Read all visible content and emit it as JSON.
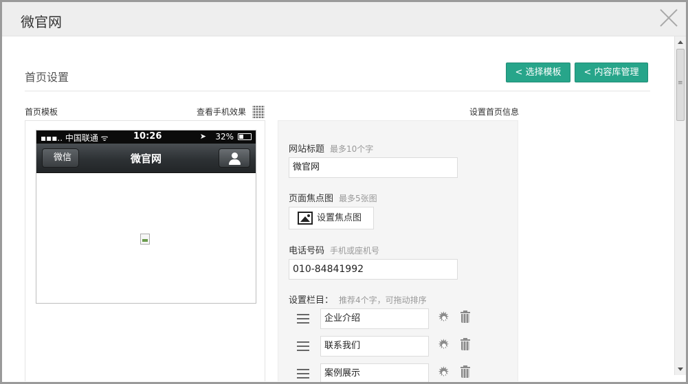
{
  "window": {
    "title": "微官网"
  },
  "page": {
    "title": "首页设置",
    "buttons": {
      "select_template": "< 选择模板",
      "content_library": "< 内容库管理"
    }
  },
  "template_panel": {
    "label": "首页模板",
    "preview_link": "查看手机效果",
    "phone": {
      "carrier": "▪▪▪.. 中国联通 ᯤ",
      "time": "10:26",
      "battery": "32%",
      "back_label": "微信",
      "nav_title": "微官网"
    }
  },
  "info_panel": {
    "label": "设置首页信息",
    "site_title": {
      "label": "网站标题",
      "hint": "最多10个字",
      "value": "微官网"
    },
    "focus_images": {
      "label": "页面焦点图",
      "hint": "最多5张图",
      "button": "设置焦点图"
    },
    "phone": {
      "label": "电话号码",
      "hint": "手机或座机号",
      "value": "010-84841992"
    },
    "columns": {
      "label": "设置栏目：",
      "hint": "推荐4个字，可拖动排序",
      "items": [
        {
          "value": "企业介绍"
        },
        {
          "value": "联系我们"
        },
        {
          "value": "案例展示"
        }
      ]
    }
  }
}
